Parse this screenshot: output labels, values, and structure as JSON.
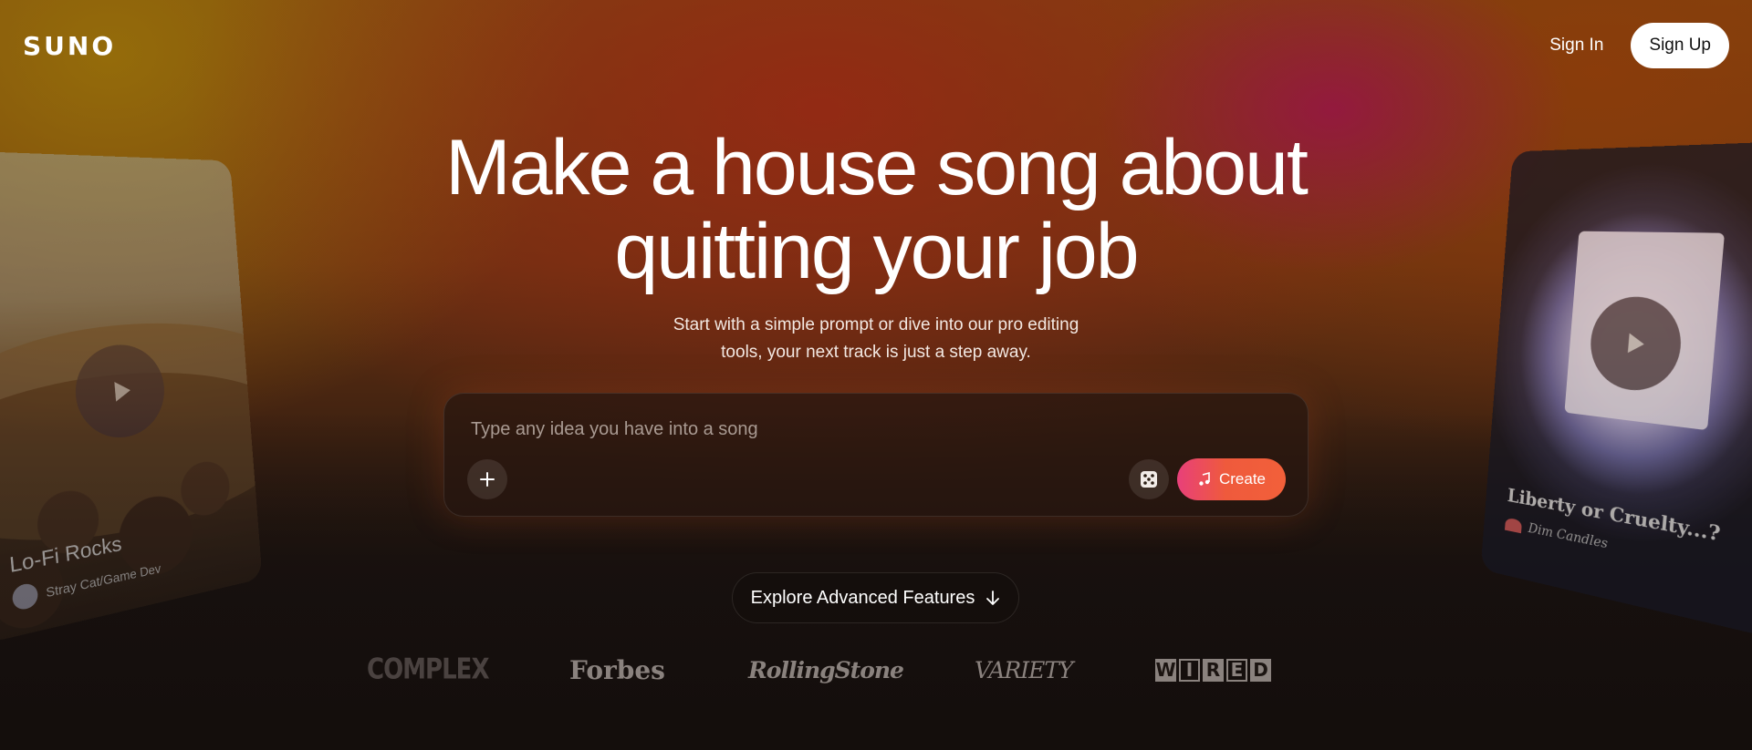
{
  "header": {
    "logo": "SUNO",
    "sign_in": "Sign In",
    "sign_up": "Sign Up"
  },
  "hero": {
    "title_line1": "Make a house song about",
    "title_line2": "quitting your job",
    "subtitle_line1": "Start with a simple prompt or dive into our pro editing",
    "subtitle_line2": "tools, your next track is just a step away."
  },
  "prompt": {
    "placeholder": "Type any idea you have into a song",
    "create_label": "Create"
  },
  "explore": {
    "label": "Explore Advanced Features"
  },
  "press_logos": {
    "complex": "COMPLEX",
    "forbes": "Forbes",
    "rolling_stone": "RollingStone",
    "variety": "VARIETY",
    "wired": [
      "W",
      "I",
      "R",
      "E",
      "D"
    ]
  },
  "cards": {
    "left": {
      "title": "Lo-Fi Rocks",
      "artist": "Stray Cat/Game Dev"
    },
    "right": {
      "title": "Liberty or Cruelty...?",
      "artist": "Dim Candles"
    }
  },
  "colors": {
    "create_gradient_start": "#e8407a",
    "create_gradient_end": "#f2603a",
    "background_dark": "#1b1411"
  }
}
